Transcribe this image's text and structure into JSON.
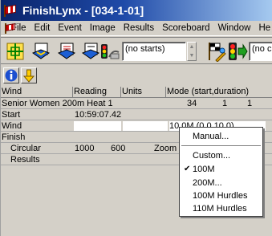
{
  "window": {
    "title": "FinishLynx - [034-1-01]"
  },
  "menubar": {
    "items": [
      "File",
      "Edit",
      "Event",
      "Image",
      "Results",
      "Scoreboard",
      "Window",
      "He"
    ]
  },
  "toolbar": {
    "starts_combo": "(no starts)",
    "camera_combo": "(no ca"
  },
  "grid": {
    "headers": [
      "Wind",
      "Reading",
      "Units",
      "Mode (start,duration)"
    ],
    "rows": [
      {
        "label": "Senior Women 200m Heat 1",
        "reading": "",
        "units": "",
        "mode_a": "34",
        "mode_b": "1",
        "mode_c": "1"
      },
      {
        "label": "Start",
        "reading": "10:59:07.42"
      },
      {
        "label": "Wind",
        "reading": "",
        "units": "",
        "mode_a": "10.0M (0.0,10.0)"
      },
      {
        "label": "Finish"
      },
      {
        "label": "Circular",
        "reading": "1000",
        "units": "600",
        "extra": "Zoom"
      },
      {
        "label": "Results"
      }
    ]
  },
  "context_menu": {
    "items": [
      {
        "label": "Manual...",
        "checked": false
      },
      {
        "label": "Custom...",
        "checked": false
      },
      {
        "label": "100M",
        "checked": true
      },
      {
        "label": "200M...",
        "checked": false
      },
      {
        "label": "100M Hurdles",
        "checked": false
      },
      {
        "label": "110M Hurdles",
        "checked": false
      }
    ],
    "check_glyph": "✔"
  },
  "colors": {
    "titlebar_start": "#0a246a",
    "titlebar_end": "#a6caf0",
    "face": "#d4d0c8"
  }
}
